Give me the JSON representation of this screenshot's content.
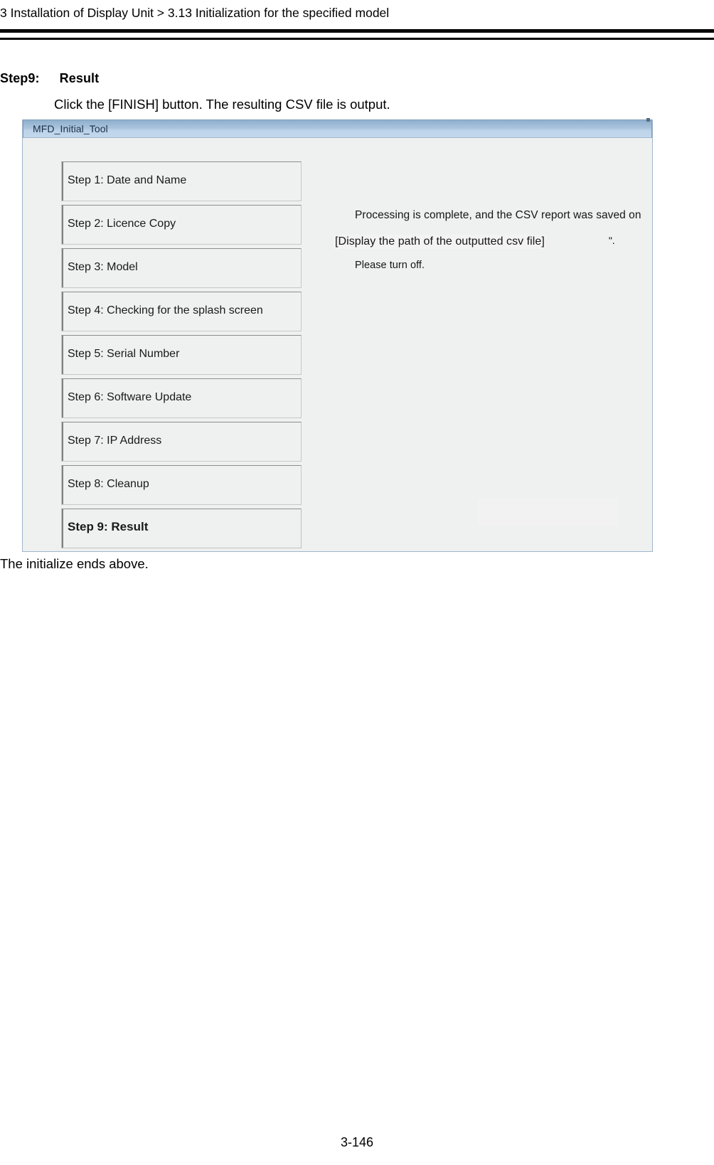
{
  "document": {
    "running_header": "3 Installation of Display Unit > 3.13 Initialization for the specified model",
    "page_number": "3-146",
    "closing_note": "The initialize ends above."
  },
  "section": {
    "step_label": "Step9:",
    "step_title": "Result",
    "instruction": "Click the [FINISH] button. The resulting CSV file is output."
  },
  "app_window": {
    "title": "MFD_Initial_Tool",
    "steps": [
      {
        "label": "Step 1: Date and Name",
        "active": false
      },
      {
        "label": "Step 2: Licence Copy",
        "active": false
      },
      {
        "label": "Step 3: Model",
        "active": false
      },
      {
        "label": "Step 4: Checking for the splash screen",
        "active": false
      },
      {
        "label": "Step 5: Serial Number",
        "active": false
      },
      {
        "label": "Step 6: Software Update",
        "active": false
      },
      {
        "label": "Step 7: IP Address",
        "active": false
      },
      {
        "label": "Step 8: Cleanup",
        "active": false
      },
      {
        "label": "Step 9: Result",
        "active": true
      }
    ],
    "message": {
      "line1": "Processing is complete, and the CSV report was saved on",
      "line2": "[Display the path of the outputted csv file]",
      "line2_suffix": "\".",
      "line3": "Please turn off."
    }
  },
  "colors": {
    "titlebar_top": "#8fafcd",
    "titlebar_bottom": "#c3d8ec",
    "window_background": "#eff0f0",
    "window_border": "#9fb6cd",
    "step_box_border": "#c8c8c8",
    "step_accent": "#808080",
    "text": "#000000"
  }
}
